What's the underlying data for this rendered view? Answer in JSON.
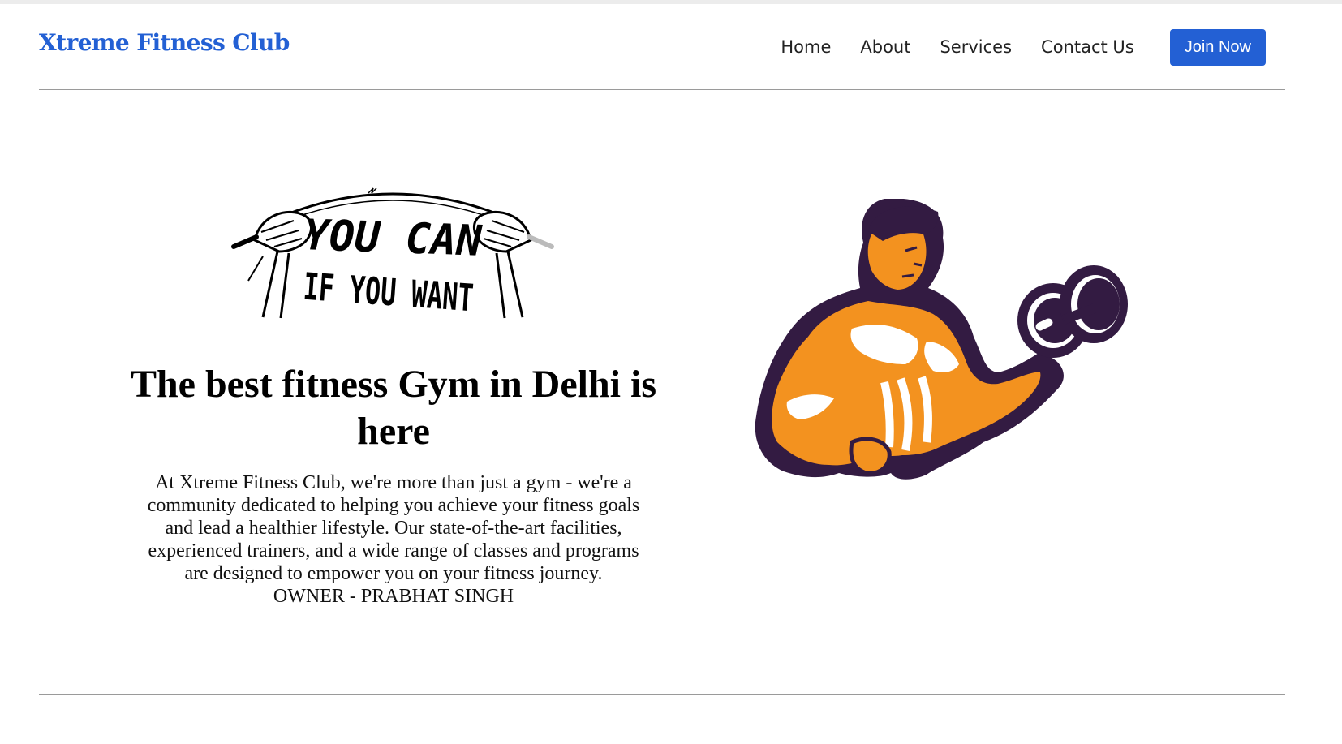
{
  "header": {
    "brand": "Xtreme Fitness Club",
    "nav": [
      "Home",
      "About",
      "Services",
      "Contact Us"
    ],
    "cta": "Join Now"
  },
  "hero": {
    "motto_top": "YOU CAN",
    "motto_bottom": "IF YOU WANT",
    "headline": "The best fitness Gym in Delhi is here",
    "description": "At Xtreme Fitness Club, we're more than just a gym - we're a community dedicated to helping you achieve your fitness goals and lead a healthier lifestyle. Our state-of-the-art facilities, experienced trainers, and a wide range of classes and programs are designed to empower you on your fitness journey.",
    "owner": "OWNER - PRABHAT SINGH"
  },
  "colors": {
    "brand": "#2360d4",
    "athlete_orange": "#f3921f",
    "athlete_purple": "#331b42"
  }
}
